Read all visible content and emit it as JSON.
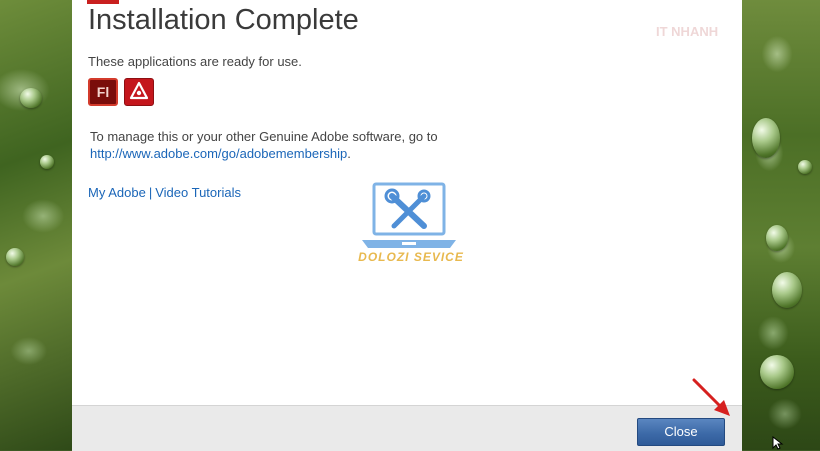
{
  "dialog": {
    "title": "Installation Complete",
    "subtitle": "These applications are ready for use.",
    "apps": [
      {
        "name": "Flash",
        "label": "Fl"
      },
      {
        "name": "Acrobat",
        "label": ""
      }
    ],
    "manage_text": "To manage this or your other Genuine Adobe software, go to",
    "membership_link": "http://www.adobe.com/go/adobemembership",
    "membership_suffix": ".",
    "links": {
      "my_adobe": "My Adobe",
      "separator": "|",
      "video_tutorials": "Video Tutorials"
    },
    "footer": {
      "close_label": "Close"
    }
  },
  "watermark": {
    "center_text": "DOLOZI SEVICE",
    "corner_text": "IT NHANH"
  },
  "colors": {
    "link": "#1b66b8",
    "button": "#3d6aa8",
    "arrow": "#d6201f",
    "adobe_red": "#c9201f"
  }
}
